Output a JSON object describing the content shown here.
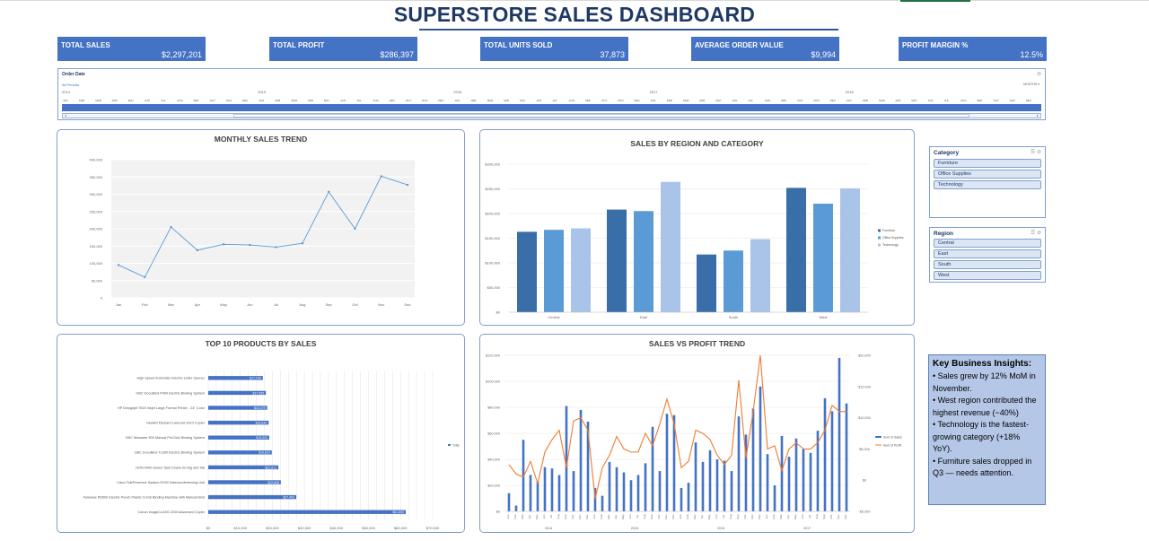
{
  "header": {
    "title": "SUPERSTORE SALES DASHBOARD"
  },
  "kpis": [
    {
      "label": "TOTAL SALES",
      "value": "$2,297,201"
    },
    {
      "label": "TOTAL PROFIT",
      "value": "$286,397"
    },
    {
      "label": "TOTAL UNITS SOLD",
      "value": "37,873"
    },
    {
      "label": "AVERAGE ORDER VALUE",
      "value": "$9,994"
    },
    {
      "label": "PROFIT MARGIN %",
      "value": "12.5%"
    }
  ],
  "timeline": {
    "title": "Order Date",
    "subtitle": "All Periods",
    "unit": "MONTHS",
    "years": [
      "2014",
      "2015",
      "2016",
      "2017",
      "2018"
    ],
    "months": [
      "JAN",
      "FEB",
      "MAR",
      "APR",
      "MAY",
      "JUN",
      "JUL",
      "AUG",
      "SEP",
      "OCT",
      "NOV",
      "DEC"
    ]
  },
  "slicers": {
    "category": {
      "title": "Category",
      "items": [
        "Furniture",
        "Office Supplies",
        "Technology"
      ]
    },
    "region": {
      "title": "Region",
      "items": [
        "Central",
        "East",
        "South",
        "West"
      ]
    }
  },
  "insights": {
    "title": "Key Business Insights:",
    "lines": [
      "• Sales grew by 12% MoM in November.",
      "• West region contributed the highest revenue (~40%)",
      "• Technology is the fastest-growing category (+18% YoY).",
      "• Furniture sales dropped in Q3 — needs attention."
    ]
  },
  "colors": {
    "kpi_bg": "#4472c4",
    "title": "#1f3864",
    "furniture": "#3a6ea8",
    "office_supplies": "#5b9bd5",
    "technology": "#a9c4e8",
    "profit_line": "#ed7d31",
    "sales_bar": "#4472c4"
  },
  "chart_data": [
    {
      "type": "line",
      "title": "MONTHLY SALES TREND",
      "categories": [
        "Jan",
        "Feb",
        "Mar",
        "Apr",
        "May",
        "Jun",
        "Jul",
        "Aug",
        "Sep",
        "Oct",
        "Nov",
        "Dec"
      ],
      "values": [
        95000,
        60000,
        205000,
        138000,
        155000,
        153000,
        147000,
        158000,
        307000,
        200000,
        352000,
        327000
      ],
      "ylim": [
        0,
        400000
      ],
      "yticks": [
        "0",
        "50,000",
        "100,000",
        "150,000",
        "200,000",
        "250,000",
        "300,000",
        "350,000",
        "400,000"
      ],
      "grid": true
    },
    {
      "type": "bar",
      "title": "SALES BY REGION AND CATEGORY",
      "categories": [
        "Central",
        "East",
        "South",
        "West"
      ],
      "series": [
        {
          "name": "Furniture",
          "values": [
            163000,
            208000,
            117000,
            252000
          ]
        },
        {
          "name": "Office Supplies",
          "values": [
            167000,
            205000,
            125000,
            220000
          ]
        },
        {
          "name": "Technology",
          "values": [
            170000,
            264000,
            148000,
            251000
          ]
        }
      ],
      "ylim": [
        0,
        300000
      ],
      "yticks": [
        "$0",
        "$50,000",
        "$100,000",
        "$150,000",
        "$200,000",
        "$250,000",
        "$300,000"
      ],
      "legend": "right"
    },
    {
      "type": "bar",
      "orientation": "horizontal",
      "title": "TOP 10 PRODUCTS BY SALES",
      "categories": [
        "High Speed Automatic Electric Letter Opener",
        "GBC DocuBind P400 Electric Binding System",
        "HP Designjet T520 Inkjet Large Format Printer - 24\" Color",
        "Hewlett Packard LaserJet 3310 Copier",
        "GBC Ibimaster 500 Manual ProClick Binding System",
        "GBC DocuBind TL300 Electric Binding System",
        "HON 5400 Series Task Chairs for Big and Tall",
        "Cisco TelePresence System EX90 Videoconferencing Unit",
        "Fellowes PB500 Electric Punch Plastic Comb Binding Machine with Manual Bind",
        "Canon imageCLASS 2200 Advanced Copier"
      ],
      "values": [
        17030,
        17965,
        18375,
        18840,
        19024,
        19823,
        21871,
        22638,
        27453,
        61600
      ],
      "value_labels": [
        "$17,030",
        "$17,965",
        "$18,375",
        "$18,840",
        "$19,024",
        "$19,823",
        "$21,871",
        "$22,638",
        "$27,453",
        "$61,600"
      ],
      "xlim": [
        0,
        70000
      ],
      "xticks": [
        "$0",
        "$10,000",
        "$20,000",
        "$30,000",
        "$40,000",
        "$50,000",
        "$60,000",
        "$70,000"
      ],
      "legend_entries": [
        "Total"
      ]
    },
    {
      "type": "bar",
      "title": "SALES VS PROFIT TREND",
      "years": [
        "2014",
        "2015",
        "2016",
        "2017"
      ],
      "categories": [
        "Jan",
        "Feb",
        "Mar",
        "Apr",
        "May",
        "Jun",
        "Jul",
        "Aug",
        "Sep",
        "Oct",
        "Nov",
        "Dec",
        "Jan",
        "Feb",
        "Mar",
        "Apr",
        "May",
        "Jun",
        "Jul",
        "Aug",
        "Sep",
        "Oct",
        "Nov",
        "Dec",
        "Jan",
        "Feb",
        "Mar",
        "Apr",
        "May",
        "Jun",
        "Jul",
        "Aug",
        "Sep",
        "Oct",
        "Nov",
        "Dec",
        "Jan",
        "Feb",
        "Mar",
        "Apr",
        "May",
        "Jun",
        "Jul",
        "Aug",
        "Sep",
        "Oct",
        "Nov",
        "Dec"
      ],
      "series": [
        {
          "name": "Sum of Sales",
          "axis": "left",
          "values": [
            14000,
            4500,
            55000,
            28000,
            23000,
            34000,
            33000,
            28000,
            81000,
            31000,
            78000,
            69000,
            18000,
            12000,
            38000,
            34000,
            30000,
            24000,
            28000,
            37000,
            65000,
            31000,
            75000,
            74000,
            18000,
            22000,
            53000,
            38000,
            47000,
            40000,
            39000,
            31000,
            73000,
            59000,
            79000,
            96000,
            44000,
            20000,
            58000,
            42000,
            56000,
            48000,
            45000,
            62000,
            87000,
            77000,
            118000,
            83000
          ]
        },
        {
          "name": "Sum of Profit",
          "axis": "right",
          "values": [
            2500,
            1000,
            500,
            3000,
            -500,
            4500,
            6500,
            8000,
            2000,
            9500,
            10000,
            8000,
            -3000,
            2000,
            4000,
            7000,
            5000,
            4500,
            4500,
            7500,
            5500,
            9000,
            13000,
            9000,
            2000,
            3000,
            8000,
            7500,
            6500,
            4000,
            2500,
            4000,
            16000,
            3500,
            11000,
            20000,
            5000,
            5500,
            1500,
            5000,
            6000,
            5000,
            5000,
            6000,
            8000,
            12000,
            11000,
            11000
          ]
        }
      ],
      "ylim_left": [
        0,
        120000
      ],
      "yticks_left": [
        "$0",
        "$20,000",
        "$40,000",
        "$60,000",
        "$80,000",
        "$100,000",
        "$120,000"
      ],
      "ylim_right": [
        -5000,
        20000
      ],
      "yticks_right": [
        "-$5,000",
        "$0",
        "$5,000",
        "$10,000",
        "$15,000",
        "$20,000"
      ],
      "legend": "right"
    }
  ]
}
